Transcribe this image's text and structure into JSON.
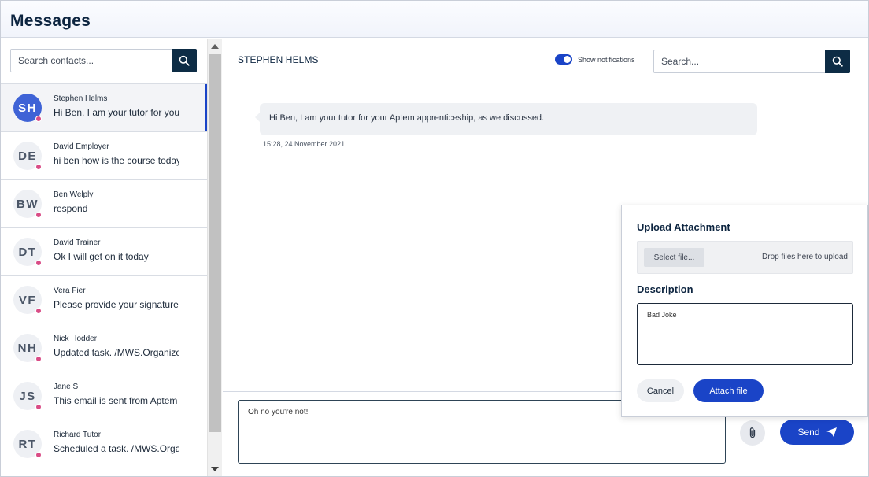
{
  "header": {
    "title": "Messages"
  },
  "contacts_panel": {
    "search_placeholder": "Search contacts...",
    "contacts": [
      {
        "initials": "SH",
        "name": "Stephen Helms",
        "preview": "Hi Ben, I am your tutor for you..."
      },
      {
        "initials": "DE",
        "name": "David Employer",
        "preview": "hi ben how is the course today?"
      },
      {
        "initials": "BW",
        "name": "Ben Welply",
        "preview": "respond"
      },
      {
        "initials": "DT",
        "name": "David Trainer",
        "preview": "Ok I will get on it today"
      },
      {
        "initials": "VF",
        "name": "Vera Fier",
        "preview": "Please provide your signature f..."
      },
      {
        "initials": "NH",
        "name": "Nick Hodder",
        "preview": "Updated task. /MWS.Organize..."
      },
      {
        "initials": "JS",
        "name": "Jane S",
        "preview": "This email is sent from Aptem ..."
      },
      {
        "initials": "RT",
        "name": "Richard Tutor",
        "preview": "Scheduled a task. /MWS.Orga..."
      }
    ]
  },
  "conversation": {
    "contact_name": "STEPHEN HELMS",
    "notifications_label": "Show notifications",
    "notifications_on": true,
    "search_placeholder": "Search...",
    "messages": [
      {
        "text": "Hi Ben, I am your tutor for your Aptem apprenticeship, as we discussed.",
        "time": "15:28, 24 November 2021"
      }
    ],
    "composer_value": "Oh no you're not!",
    "send_label": "Send"
  },
  "upload": {
    "title": "Upload Attachment",
    "select_label": "Select file...",
    "drop_text": "Drop files here to upload",
    "description_label": "Description",
    "description_value": "Bad Joke",
    "cancel_label": "Cancel",
    "attach_label": "Attach file"
  },
  "colors": {
    "accent": "#1a44c7",
    "navy": "#0d2c45",
    "status_dot": "#d94c86"
  }
}
